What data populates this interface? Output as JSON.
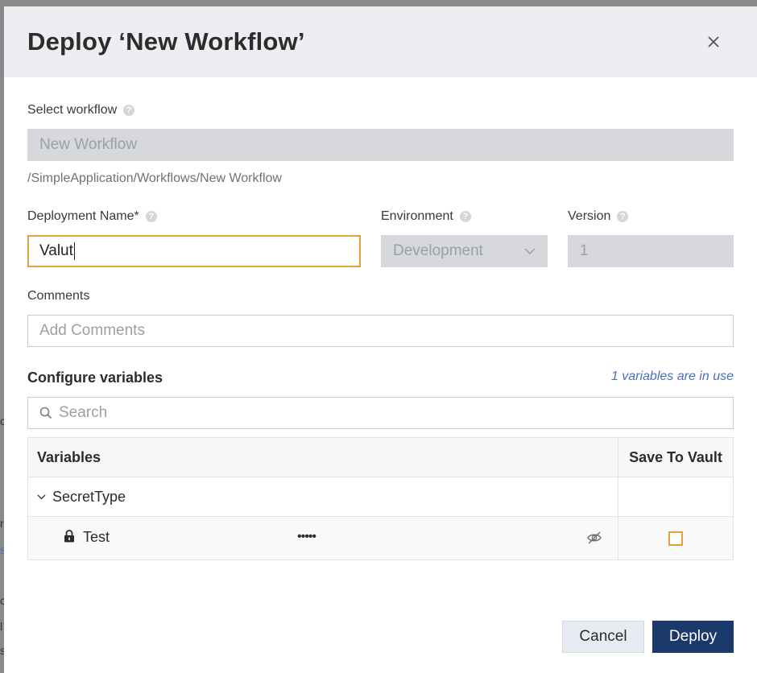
{
  "dialog": {
    "title": "Deploy ‘New Workflow’",
    "close_icon": "close-icon"
  },
  "workflow": {
    "label": "Select workflow",
    "value": "New Workflow",
    "path": "/SimpleApplication/Workflows/New Workflow"
  },
  "deployment_name": {
    "label": "Deployment Name*",
    "value": "Valut"
  },
  "environment": {
    "label": "Environment",
    "value": "Development"
  },
  "version": {
    "label": "Version",
    "value": "1"
  },
  "comments": {
    "label": "Comments",
    "placeholder": "Add Comments"
  },
  "variables": {
    "section_title": "Configure variables",
    "in_use_text": "1 variables are in use",
    "search_placeholder": "Search",
    "table": {
      "headers": [
        "Variables",
        "Save To Vault"
      ],
      "group": "SecretType",
      "rows": [
        {
          "name": "Test",
          "masked_value": "•••••",
          "save_to_vault": false
        }
      ]
    }
  },
  "footer": {
    "cancel_label": "Cancel",
    "deploy_label": "Deploy"
  },
  "colors": {
    "primary": "#1b3a6b",
    "focus_border": "#e3a23b",
    "link": "#4a6fc0",
    "header_bg": "#eceef1"
  }
}
